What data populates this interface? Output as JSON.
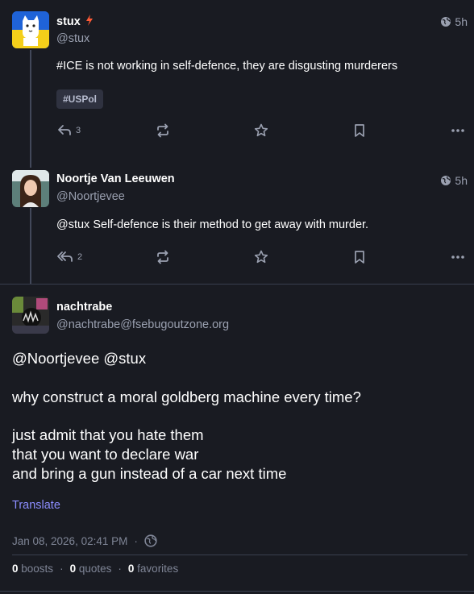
{
  "posts": [
    {
      "name": "stux",
      "handle": "@stux",
      "time": "5h",
      "text": "#ICE is not working in self-defence, they are disgusting murderers",
      "tag": "#USPol",
      "reply_count": "3"
    },
    {
      "name": "Noortje Van Leeuwen",
      "handle": "@Noortjevee",
      "time": "5h",
      "text": "@stux Self-defence is their method to get away with murder.",
      "reply_count": "2"
    }
  ],
  "focus": {
    "name": "nachtrabe",
    "handle": "@nachtrabe@fsebugoutzone.org",
    "mentions": "@Noortjevee @stux",
    "para1": "why construct a moral goldberg machine every time?",
    "line1": "just admit that you hate them",
    "line2": "that you want to declare war",
    "line3": "and bring a gun instead of a car next time",
    "translate": "Translate",
    "date": "Jan 08, 2026, 02:41 PM",
    "separator": "·",
    "boosts_count": "0",
    "boosts_label": "boosts",
    "quotes_count": "0",
    "quotes_label": "quotes",
    "favorites_count": "0",
    "favorites_label": "favorites"
  },
  "colors": {
    "background": "#191b22",
    "accent": "#8c8dff",
    "muted": "#9aa0b0",
    "bot_badge": "#ff5a36"
  }
}
